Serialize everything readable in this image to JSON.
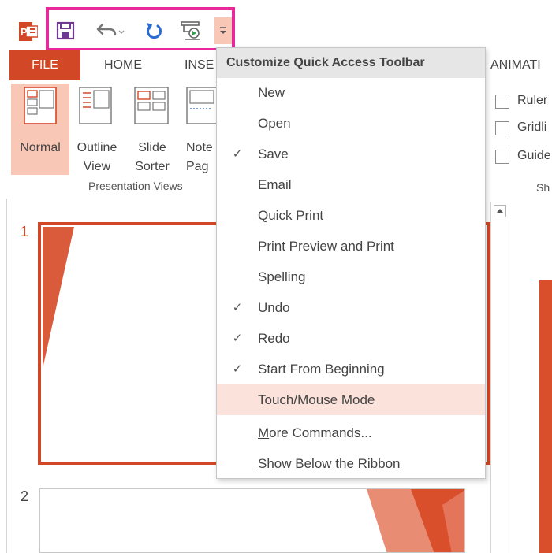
{
  "colors": {
    "accent": "#d24726",
    "highlight": "#e8289b",
    "hover": "#fbe3dc",
    "selected": "#f9c7b6"
  },
  "qat": {
    "icons": [
      "powerpoint-logo-icon",
      "save-icon",
      "undo-icon",
      "redo-icon",
      "start-from-beginning-icon",
      "customize-dropdown-icon"
    ]
  },
  "tabs": [
    "FILE",
    "HOME",
    "INSE",
    "ANIMATI"
  ],
  "ribbon": {
    "views": [
      {
        "label1": "Normal",
        "label2": ""
      },
      {
        "label1": "Outline",
        "label2": "View"
      },
      {
        "label1": "Slide",
        "label2": "Sorter"
      },
      {
        "label1": "Note",
        "label2": "Pag"
      }
    ],
    "group_label": "Presentation Views",
    "show_options": [
      "Ruler",
      "Gridli",
      "Guide"
    ],
    "show_group_label": "Sh"
  },
  "slides": {
    "first": "1",
    "second": "2"
  },
  "menu": {
    "title": "Customize Quick Access Toolbar",
    "check_glyph": "✓",
    "items": [
      {
        "label": "New",
        "checked": false
      },
      {
        "label": "Open",
        "checked": false
      },
      {
        "label": "Save",
        "checked": true
      },
      {
        "label": "Email",
        "checked": false
      },
      {
        "label": "Quick Print",
        "checked": false
      },
      {
        "label": "Print Preview and Print",
        "checked": false
      },
      {
        "label": "Spelling",
        "checked": false
      },
      {
        "label": "Undo",
        "checked": true
      },
      {
        "label": "Redo",
        "checked": true
      },
      {
        "label": "Start From Beginning",
        "checked": true
      },
      {
        "label": "Touch/Mouse Mode",
        "checked": false
      }
    ],
    "more_commands_first": "M",
    "more_commands_rest": "ore Commands...",
    "show_below_first": "S",
    "show_below_rest": "how Below the Ribbon"
  }
}
